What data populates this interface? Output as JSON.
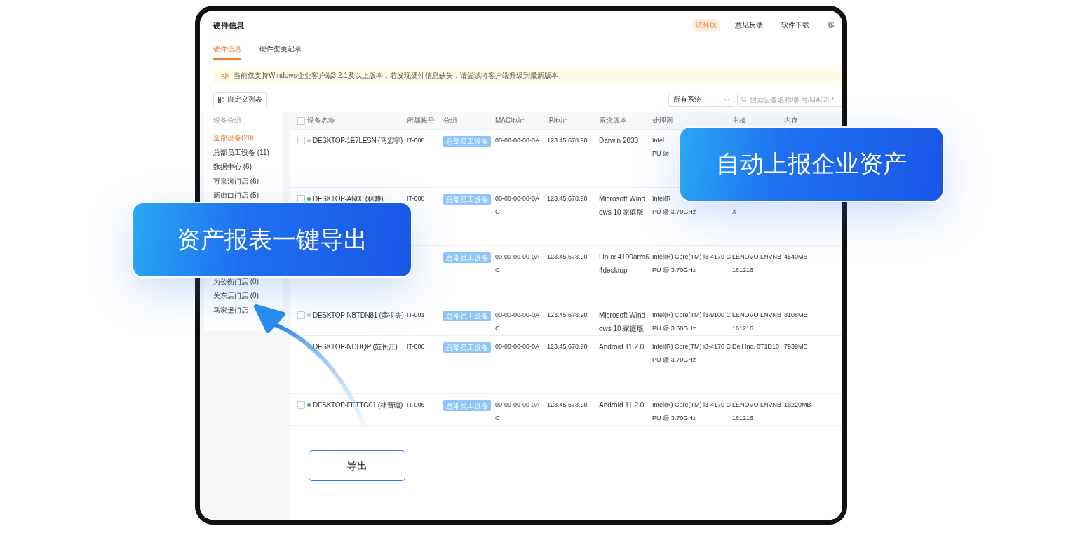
{
  "header": {
    "title": "硬件信息",
    "links": [
      {
        "label": "试环境",
        "highlighted": true
      },
      {
        "label": "意见反馈",
        "highlighted": false
      },
      {
        "label": "软件下载",
        "highlighted": false
      },
      {
        "label": "客",
        "highlighted": false
      }
    ]
  },
  "tabs": [
    {
      "label": "硬件信息",
      "selected": true
    },
    {
      "label": "硬件变更记录",
      "selected": false
    }
  ],
  "notice": "当前仅支持Windows企业客户端3.2.1及以上版本，若发现硬件信息缺失，请尝试将客户端升级到最新版本",
  "toolbar": {
    "custom_button": "自定义列表",
    "system_select": "所有系统",
    "search": {
      "placeholder": "搜索设备名称/帐号/MAC/IP"
    }
  },
  "sidebar": {
    "title": "设备分组",
    "items": [
      {
        "label": "全部设备(28)",
        "selected": true
      },
      {
        "label": "总部员工设备 (11)",
        "selected": false
      },
      {
        "label": "数据中心 (6)",
        "selected": false
      },
      {
        "label": "万泉河门店 (6)",
        "selected": false
      },
      {
        "label": "新街口门店 (5)",
        "selected": false
      },
      {
        "label": "为公衡门店 (0)",
        "selected": false
      },
      {
        "label": "关东店门店 (0)",
        "selected": false
      },
      {
        "label": "马家堡门店",
        "selected": false
      }
    ]
  },
  "table": {
    "header_checked": false,
    "columns": [
      "设备名称",
      "所属帐号",
      "分组",
      "MAC地址",
      "IP地址",
      "系统版本",
      "处理器",
      "主板",
      "内存"
    ],
    "rows": [
      {
        "checked": false,
        "online": false,
        "name": "DESKTOP-1E7LESN (马宏宇)",
        "account": "IT-008",
        "group": "总部员工设备",
        "mac": "00-00-00-00-0A",
        "ip": "123.45.678.90",
        "os": "Darwin 2030",
        "cpu": "Intel\nPU @",
        "tall": true
      },
      {
        "checked": false,
        "online": true,
        "name": "DESKTOP-AN00 (林舞)",
        "account": "IT-008",
        "group": "总部员工设备",
        "mac": "00-00-00-00-0A\nC",
        "ip": "123.45.678.90",
        "os": "Microsoft Wind\nows 10 家庭版",
        "cpu": "Intel(R\nPU @ 3.70GHz",
        "board": "\nX",
        "tall": true
      },
      {
        "group": "总部员工设备",
        "mac": "00-00-00-00-0A\nC",
        "ip": "123.45.678.90",
        "os": "Linux 4190arm6\n4desktop",
        "cpu": "Intel(R) Core(TM) i3-4170 C\nPU @ 3.70GHz",
        "board": "LENOVO LNVNB\n161216",
        "memory": "4540MB",
        "tall": true
      },
      {
        "checked": false,
        "online": false,
        "name": "DESKTOP-NBTDN81 (窦汉夫)",
        "account": "IT-001",
        "group": "总部员工设备",
        "mac": "00-00-00-00-0A\nC",
        "ip": "123.45.678.90",
        "os": "Microsoft Wind\nows 10 家庭版",
        "cpu": "Intel(R) Core(TM) i3-9100 C\nPU @ 3.60GHz",
        "board": "LENOVO LNVNB\n161216",
        "memory": "8108MB",
        "tall": false
      },
      {
        "online": false,
        "name": "DESKTOP-NDDQP (范长江)",
        "account": "IT-006",
        "group": "总部员工设备",
        "mac": "00-00-00-00-0A",
        "ip": "123.45.678.90",
        "os": "Android 11.2.0",
        "cpu": "Intel(R) Core(TM) i3-4170 C\nPU @ 3.70GHz",
        "board": "Dell Inc. 0T1D10",
        "memory": "7939MB",
        "tall": true
      },
      {
        "checked": false,
        "online": true,
        "name": "DESKTOP-FETTG01 (林晋瑭)",
        "account": "IT-006",
        "group": "总部员工设备",
        "mac": "00-00-00-00-0A\nC",
        "ip": "123.45.678.90",
        "os": "Android 11.2.0",
        "cpu": "Intel(R) Core(TM) i3-4170 C\nPU @ 3.70GHz",
        "board": "LENOVO LNVNB\n161216",
        "memory": "16220MB",
        "tall": false
      }
    ]
  },
  "callouts": [
    "自动上报企业资产",
    "资产报表一键导出"
  ],
  "export_button": "导出"
}
